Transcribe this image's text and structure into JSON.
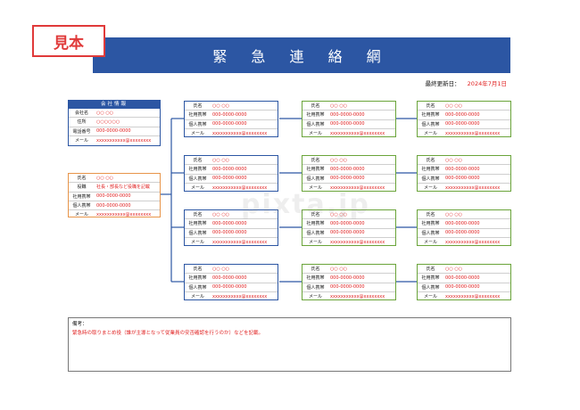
{
  "sample_badge": "見本",
  "title": "緊 急 連 絡 網",
  "last_updated": {
    "label": "最終更新日：",
    "date": "2024年7月1日"
  },
  "company": {
    "header": "会社情報",
    "rows": [
      {
        "label": "会社名",
        "value": "○○ ○○"
      },
      {
        "label": "住所",
        "value": "○○○○○○"
      },
      {
        "label": "電話番号",
        "value": "000-0000-0000"
      },
      {
        "label": "メール",
        "value": "xxxxxxxxxxx@xxxxxxxx"
      }
    ]
  },
  "leader": {
    "rows": [
      {
        "label": "氏名",
        "value": "○○ ○○"
      },
      {
        "label": "役職",
        "value": "社長・部長など役職を記載"
      },
      {
        "label": "社用携帯",
        "value": "000-0000-0000"
      },
      {
        "label": "個人携帯",
        "value": "000-0000-0000"
      },
      {
        "label": "メール",
        "value": "xxxxxxxxxxx@xxxxxxxx"
      }
    ]
  },
  "member_labels": [
    "氏名",
    "社用携帯",
    "個人携帯",
    "メール"
  ],
  "member_values": [
    "○○ ○○",
    "000-0000-0000",
    "000-0000-0000",
    "xxxxxxxxxxx@xxxxxxxx"
  ],
  "notes": {
    "title": "備考：",
    "body": "緊急時の取りまとめ役（誰が主導となって従業員の安否確認を行うのか）などを記載。"
  },
  "watermark": "pixta.jp",
  "colors": {
    "blue": "#2c56a3",
    "green": "#6aa43a",
    "orange": "#e8954a",
    "red": "#e02020"
  }
}
